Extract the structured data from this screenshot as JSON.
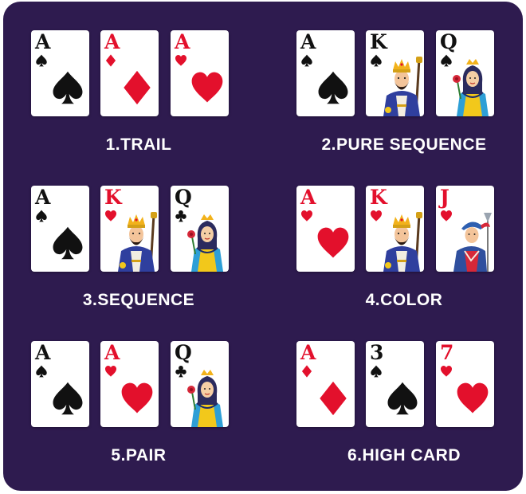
{
  "hands": [
    {
      "label": "1.TRAIL",
      "cards": [
        {
          "rank": "A",
          "suit": "spade",
          "color": "black",
          "face": "none"
        },
        {
          "rank": "A",
          "suit": "diamond",
          "color": "red",
          "face": "none"
        },
        {
          "rank": "A",
          "suit": "heart",
          "color": "red",
          "face": "none"
        }
      ]
    },
    {
      "label": "2.PURE SEQUENCE",
      "cards": [
        {
          "rank": "A",
          "suit": "spade",
          "color": "black",
          "face": "none"
        },
        {
          "rank": "K",
          "suit": "spade",
          "color": "black",
          "face": "king"
        },
        {
          "rank": "Q",
          "suit": "spade",
          "color": "black",
          "face": "queen"
        }
      ]
    },
    {
      "label": "3.SEQUENCE",
      "cards": [
        {
          "rank": "A",
          "suit": "spade",
          "color": "black",
          "face": "none"
        },
        {
          "rank": "K",
          "suit": "heart",
          "color": "red",
          "face": "king"
        },
        {
          "rank": "Q",
          "suit": "club",
          "color": "black",
          "face": "queen"
        }
      ]
    },
    {
      "label": "4.COLOR",
      "cards": [
        {
          "rank": "A",
          "suit": "heart",
          "color": "red",
          "face": "none"
        },
        {
          "rank": "K",
          "suit": "heart",
          "color": "red",
          "face": "king"
        },
        {
          "rank": "J",
          "suit": "heart",
          "color": "red",
          "face": "jack"
        }
      ]
    },
    {
      "label": "5.PAIR",
      "cards": [
        {
          "rank": "A",
          "suit": "spade",
          "color": "black",
          "face": "none"
        },
        {
          "rank": "A",
          "suit": "heart",
          "color": "red",
          "face": "none"
        },
        {
          "rank": "Q",
          "suit": "club",
          "color": "black",
          "face": "queen"
        }
      ]
    },
    {
      "label": "6.HIGH CARD",
      "cards": [
        {
          "rank": "A",
          "suit": "diamond",
          "color": "red",
          "face": "none"
        },
        {
          "rank": "3",
          "suit": "spade",
          "color": "black",
          "face": "none"
        },
        {
          "rank": "7",
          "suit": "heart",
          "color": "red",
          "face": "none"
        }
      ]
    }
  ],
  "colors": {
    "background": "#2e1b4f",
    "card": "#ffffff",
    "red": "#e3102c",
    "black": "#111111",
    "label": "#ffffff"
  }
}
